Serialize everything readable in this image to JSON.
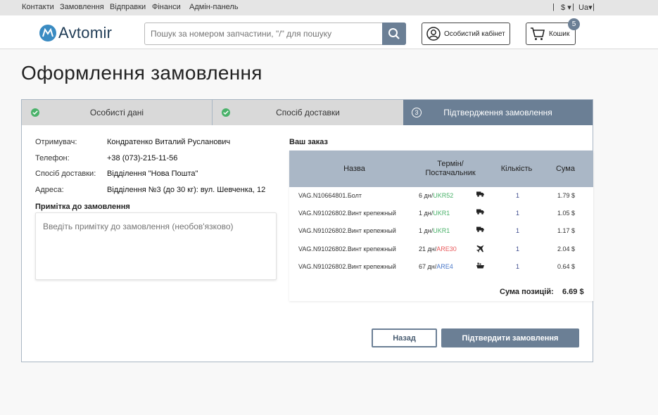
{
  "topnav": {
    "links": [
      "Контакти",
      "Замовлення",
      "Відправки",
      "Фінанси",
      "Адмін-панель"
    ],
    "currency": "$",
    "language": "Ua"
  },
  "header": {
    "logo_text": "Avtomir",
    "search_placeholder": "Пошук за номером запчастини, \"/\" для пошуку",
    "cabinet_label": "Особистий кабінет",
    "cart_label": "Кошик",
    "cart_count": "5"
  },
  "page_title": "Оформлення замовлення",
  "steps": [
    {
      "label": "Особисті дані",
      "status": "done"
    },
    {
      "label": "Спосіб доставки",
      "status": "done"
    },
    {
      "label": "Підтвердження замовлення",
      "number": "3",
      "status": "active"
    }
  ],
  "recipient": {
    "fields": [
      {
        "key": "Отримувач:",
        "value": "Кондратенко Виталий Русланович"
      },
      {
        "key": "Телефон:",
        "value": "+38 (073)-215-11-56"
      },
      {
        "key": "Спосіб доставки:",
        "value": "Відділення \"Нова Пошта\""
      },
      {
        "key": "Адреса:",
        "value": "Відділення №3 (до 30 кг): вул. Шевченка, 12"
      }
    ],
    "note_label": "Примітка до замовлення",
    "note_placeholder": "Введіть примітку до замовлення (необов'язково)"
  },
  "order": {
    "title": "Ваш заказ",
    "columns": {
      "name": "Назва",
      "term": "Термін/ Постачальник",
      "qty": "Кількість",
      "sum": "Сума"
    },
    "rows": [
      {
        "name": "VAG.N10664801.Болт",
        "term": "6 дн/",
        "supplier": "UKR52",
        "supplier_color": "#4ab26a",
        "transport": "truck-icon",
        "qty": "1",
        "sum": "1.79 $"
      },
      {
        "name": "VAG.N91026802.Винт крепежный",
        "term": "1 дн/",
        "supplier": "UKR1",
        "supplier_color": "#4ab26a",
        "transport": "truck-icon",
        "qty": "1",
        "sum": "1.05 $"
      },
      {
        "name": "VAG.N91026802.Винт крепежный",
        "term": "1 дн/",
        "supplier": "UKR1",
        "supplier_color": "#4ab26a",
        "transport": "truck-icon",
        "qty": "1",
        "sum": "1.17 $"
      },
      {
        "name": "VAG.N91026802.Винт крепежный",
        "term": "21 дн/",
        "supplier": "ARE30",
        "supplier_color": "#e8585a",
        "transport": "plane-icon",
        "qty": "1",
        "sum": "2.04 $"
      },
      {
        "name": "VAG.N91026802.Винт крепежный",
        "term": "67 дн/",
        "supplier": "ARE4",
        "supplier_color": "#4a77c8",
        "transport": "ship-icon",
        "qty": "1",
        "sum": "0.64 $"
      }
    ],
    "total_label": "Сума позицій:",
    "total_value": "6.69 $"
  },
  "actions": {
    "back_label": "Назад",
    "confirm_label": "Підтвердити замовлення"
  },
  "colors": {
    "accent": "#6b7f95",
    "table_header": "#aab7c6",
    "done_green": "#4ab26a"
  }
}
